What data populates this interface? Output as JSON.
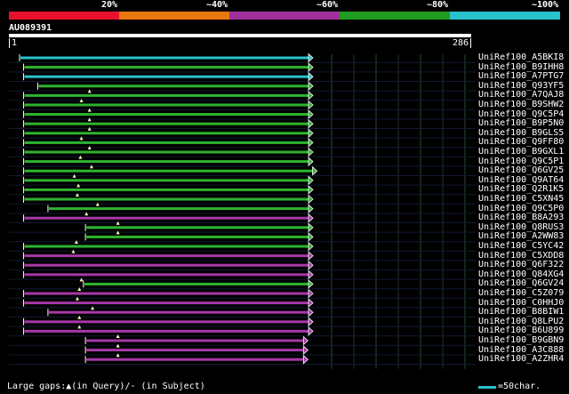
{
  "legend": {
    "segments": [
      {
        "color": "#e8112d"
      },
      {
        "color": "#e87711"
      },
      {
        "color": "#a02f9c"
      },
      {
        "color": "#219c21"
      },
      {
        "color": "#29c2cc"
      }
    ],
    "labels": [
      "20%",
      "~40%",
      "~60%",
      "~80%",
      "~100%"
    ]
  },
  "query": {
    "id": "AU089391",
    "start": "1",
    "end": "286",
    "length": 286
  },
  "colors": {
    "green": "#2fb32f",
    "purple": "#a638a6",
    "cyan": "#29c2cc",
    "grid": "#2c4a2c"
  },
  "hits": [
    {
      "name": "UniRef100_A5BKI8",
      "color": "cyan",
      "start": 1,
      "end": 286,
      "gaps": []
    },
    {
      "name": "UniRef100_B9IHH8",
      "color": "green",
      "start": 5,
      "end": 286,
      "gaps": []
    },
    {
      "name": "UniRef100_A7PTG7",
      "color": "cyan",
      "start": 5,
      "end": 286,
      "gaps": []
    },
    {
      "name": "UniRef100_Q93YF5",
      "color": "green",
      "start": 19,
      "end": 286,
      "gaps": []
    },
    {
      "name": "UniRef100_A7QAJ8",
      "color": "green",
      "start": 5,
      "end": 286,
      "gaps": [
        70
      ]
    },
    {
      "name": "UniRef100_B9SHW2",
      "color": "green",
      "start": 5,
      "end": 286,
      "gaps": [
        62
      ]
    },
    {
      "name": "UniRef100_Q9C5P4",
      "color": "green",
      "start": 5,
      "end": 286,
      "gaps": [
        70
      ]
    },
    {
      "name": "UniRef100_B9P5N0",
      "color": "green",
      "start": 5,
      "end": 286,
      "gaps": [
        70
      ]
    },
    {
      "name": "UniRef100_B9GLS5",
      "color": "green",
      "start": 5,
      "end": 286,
      "gaps": [
        70
      ]
    },
    {
      "name": "UniRef100_Q9FF80",
      "color": "green",
      "start": 5,
      "end": 286,
      "gaps": [
        62
      ]
    },
    {
      "name": "UniRef100_B9GXL1",
      "color": "green",
      "start": 5,
      "end": 286,
      "gaps": [
        70
      ]
    },
    {
      "name": "UniRef100_Q9C5P1",
      "color": "green",
      "start": 5,
      "end": 286,
      "gaps": [
        61
      ]
    },
    {
      "name": "UniRef100_Q6GV25",
      "color": "green",
      "start": 5,
      "end": 290,
      "gaps": [
        72
      ]
    },
    {
      "name": "UniRef100_Q9AT64",
      "color": "green",
      "start": 5,
      "end": 286,
      "gaps": [
        55
      ]
    },
    {
      "name": "UniRef100_Q2R1K5",
      "color": "green",
      "start": 5,
      "end": 286,
      "gaps": [
        59
      ]
    },
    {
      "name": "UniRef100_C5XN45",
      "color": "green",
      "start": 5,
      "end": 286,
      "gaps": [
        58
      ]
    },
    {
      "name": "UniRef100_Q9C5P0",
      "color": "green",
      "start": 29,
      "end": 286,
      "gaps": [
        78
      ]
    },
    {
      "name": "UniRef100_B8A293",
      "color": "purple",
      "start": 5,
      "end": 286,
      "gaps": [
        67
      ]
    },
    {
      "name": "UniRef100_Q8RUS3",
      "color": "green",
      "start": 66,
      "end": 286,
      "gaps": [
        98
      ]
    },
    {
      "name": "UniRef100_A2WW83",
      "color": "green",
      "start": 66,
      "end": 286,
      "gaps": [
        98
      ]
    },
    {
      "name": "UniRef100_C5YC42",
      "color": "green",
      "start": 5,
      "end": 286,
      "gaps": [
        57
      ]
    },
    {
      "name": "UniRef100_C5XDD8",
      "color": "purple",
      "start": 5,
      "end": 286,
      "gaps": [
        54
      ]
    },
    {
      "name": "UniRef100_Q6F322",
      "color": "purple",
      "start": 5,
      "end": 286,
      "gaps": []
    },
    {
      "name": "UniRef100_Q84XG4",
      "color": "purple",
      "start": 5,
      "end": 286,
      "gaps": []
    },
    {
      "name": "UniRef100_Q6GV24",
      "color": "green",
      "start": 64,
      "end": 286,
      "gaps": [
        62
      ]
    },
    {
      "name": "UniRef100_C5Z079",
      "color": "purple",
      "start": 5,
      "end": 286,
      "gaps": [
        60
      ]
    },
    {
      "name": "UniRef100_C0HHJ0",
      "color": "purple",
      "start": 5,
      "end": 286,
      "gaps": [
        58
      ]
    },
    {
      "name": "UniRef100_B8BIW1",
      "color": "purple",
      "start": 29,
      "end": 286,
      "gaps": [
        73
      ]
    },
    {
      "name": "UniRef100_Q8LPU2",
      "color": "purple",
      "start": 5,
      "end": 286,
      "gaps": [
        60
      ]
    },
    {
      "name": "UniRef100_B6U899",
      "color": "purple",
      "start": 5,
      "end": 286,
      "gaps": [
        60
      ]
    },
    {
      "name": "UniRef100_B9GBN9",
      "color": "purple",
      "start": 66,
      "end": 281,
      "gaps": [
        98
      ]
    },
    {
      "name": "UniRef100_A3C888",
      "color": "purple",
      "start": 66,
      "end": 281,
      "gaps": [
        98
      ]
    },
    {
      "name": "UniRef100_A2ZHR4",
      "color": "purple",
      "start": 66,
      "end": 281,
      "gaps": [
        98
      ]
    }
  ],
  "footer": {
    "gaps_text": "Large gaps:▲(in Query)/- (in Subject)",
    "scale_text": "=50char."
  }
}
